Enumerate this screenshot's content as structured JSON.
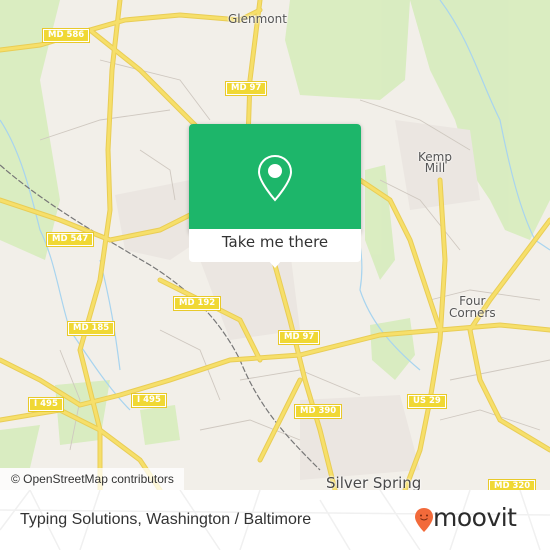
{
  "map": {
    "places": [
      {
        "id": "glenmont",
        "label": "Glenmont"
      },
      {
        "id": "kemp-mill",
        "label": "Kemp\nMill"
      },
      {
        "id": "four-corners",
        "label": "Four\nCorners"
      },
      {
        "id": "silver-spring",
        "label": "Silver Spring"
      }
    ],
    "route_shields": [
      {
        "id": "md-586",
        "label": "MD 586"
      },
      {
        "id": "md-97-north",
        "label": "MD 97"
      },
      {
        "id": "md-547",
        "label": "MD 547"
      },
      {
        "id": "md-192",
        "label": "MD 192"
      },
      {
        "id": "md-185",
        "label": "MD 185"
      },
      {
        "id": "md-97-south",
        "label": "MD 97"
      },
      {
        "id": "i-495-west",
        "label": "I 495"
      },
      {
        "id": "i-495-east",
        "label": "I 495"
      },
      {
        "id": "md-390",
        "label": "MD 390"
      },
      {
        "id": "us-29",
        "label": "US 29"
      },
      {
        "id": "md-320",
        "label": "MD 320"
      }
    ],
    "attribution": "© OpenStreetMap contributors",
    "colors": {
      "land": "#f2efe9",
      "park": "#d4ebb8",
      "road_major": "#f6df6a",
      "water": "#a8d4ef"
    }
  },
  "popup": {
    "icon": "map-pin-icon",
    "cta_label": "Take me there",
    "accent_color": "#1db66a"
  },
  "footer": {
    "title": "Typing Solutions, Washington / Baltimore",
    "brand": {
      "name": "moovit",
      "icon": "moovit-smiley-pin-icon",
      "icon_color": "#f26a3a"
    }
  }
}
